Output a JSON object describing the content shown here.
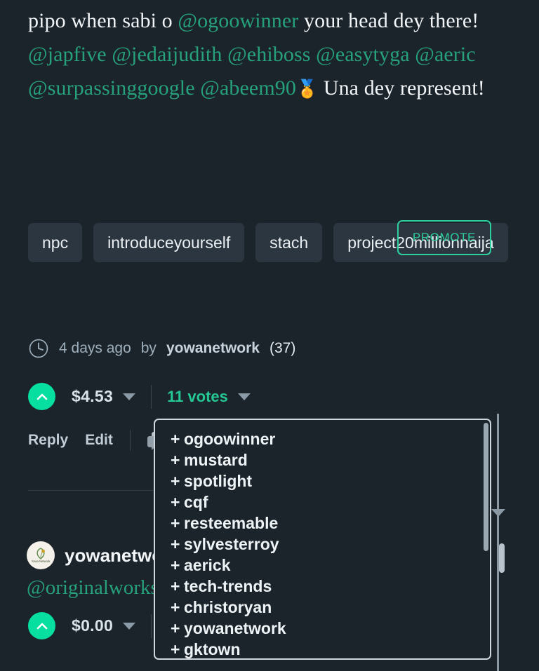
{
  "post": {
    "body_segments": [
      {
        "type": "text",
        "value": "pipo when sabi o "
      },
      {
        "type": "mention",
        "value": "@ogoowinner"
      },
      {
        "type": "text",
        "value": " your head dey there! "
      },
      {
        "type": "mention",
        "value": "@japfive"
      },
      {
        "type": "text",
        "value": " "
      },
      {
        "type": "mention",
        "value": "@jedaijudith"
      },
      {
        "type": "text",
        "value": " "
      },
      {
        "type": "mention",
        "value": "@ehiboss"
      },
      {
        "type": "text",
        "value": " "
      },
      {
        "type": "mention",
        "value": "@easytyga"
      },
      {
        "type": "text",
        "value": " "
      },
      {
        "type": "mention",
        "value": "@aeric"
      },
      {
        "type": "text",
        "value": " "
      },
      {
        "type": "mention",
        "value": "@surpassinggoogle"
      },
      {
        "type": "text",
        "value": " "
      },
      {
        "type": "mention",
        "value": "@abeem90"
      },
      {
        "type": "emoji",
        "value": "🏅"
      },
      {
        "type": "text",
        "value": " Una dey represent!"
      }
    ],
    "tags": [
      "npc",
      "introduceyourself",
      "stach",
      "project20millionnaija"
    ],
    "promote_label": "PROMOTE",
    "meta": {
      "clock_icon": "clock-icon",
      "time_ago": "4 days ago",
      "by_label": "by",
      "author": "yowanetwork",
      "reputation": "(37)"
    },
    "vote": {
      "upvote_icon": "chevron-up-icon",
      "payout": "$4.53",
      "payout_caret_icon": "chevron-down-icon",
      "votes": "11 votes",
      "votes_caret_icon": "chevron-down-icon"
    },
    "actions": {
      "reply_label": "Reply",
      "edit_label": "Edit",
      "resteem_icon": "resteem-icon"
    }
  },
  "comment": {
    "avatar_label": "Yowa Network",
    "author": "yowanetwo",
    "text": "@originalworks",
    "vote": {
      "upvote_icon": "chevron-up-icon",
      "payout": "$0.00",
      "payout_caret_icon": "chevron-down-icon"
    }
  },
  "dropdown": {
    "items": [
      "ogoowinner",
      "mustard",
      "spotlight",
      "cqf",
      "resteemable",
      "sylvesterroy",
      "aerick",
      "tech-trends",
      "christoryan",
      "yowanetwork",
      "gktown"
    ],
    "prefix": "+"
  },
  "colors": {
    "background": "#1c242b",
    "accent_teal": "#26a17b",
    "accent_mint": "#06dfa0",
    "promote_border": "#2ecf9e",
    "tag_background": "#2b3640"
  }
}
